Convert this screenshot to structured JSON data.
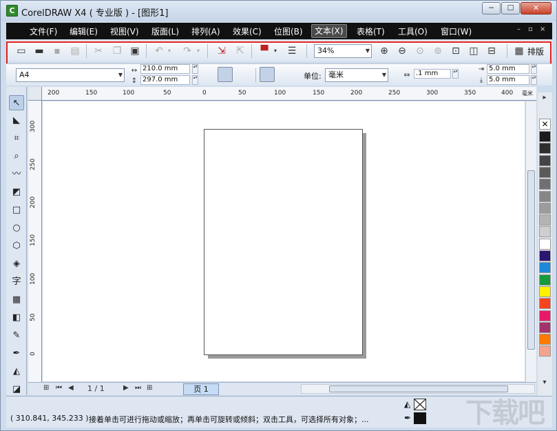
{
  "window": {
    "title": "CorelDRAW X4 ( 专业版 ) - [图形1]",
    "app_icon": "coreldraw-app-icon",
    "minimize": "─",
    "maximize": "☐",
    "close": "✕"
  },
  "menu": {
    "items": [
      "文件(F)",
      "编辑(E)",
      "视图(V)",
      "版面(L)",
      "排列(A)",
      "效果(C)",
      "位图(B)",
      "文本(X)",
      "表格(T)",
      "工具(O)",
      "窗口(W)"
    ],
    "active_index": 7,
    "mdi_min": "–",
    "mdi_restore": "▫",
    "mdi_close": "×"
  },
  "standard_toolbar": {
    "zoom_value": "34%",
    "layout_label": "排版"
  },
  "property_bar": {
    "paper_size": "A4",
    "width": "210.0 mm",
    "height": "297.0 mm",
    "units_label": "单位:",
    "units_value": "毫米",
    "nudge": ".1 mm",
    "dup_x": "5.0 mm",
    "dup_y": "5.0 mm"
  },
  "rulers": {
    "h_ticks": [
      "200",
      "150",
      "100",
      "50",
      "0",
      "50",
      "100",
      "150",
      "200",
      "250",
      "300",
      "350",
      "400"
    ],
    "h_unit": "毫米",
    "v_ticks": [
      "300",
      "250",
      "200",
      "150",
      "100",
      "50",
      "0"
    ]
  },
  "toolbox": {
    "icons": [
      "pick-tool-icon",
      "shape-tool-icon",
      "crop-tool-icon",
      "zoom-tool-icon",
      "freehand-tool-icon",
      "smart-fill-tool-icon",
      "rectangle-tool-icon",
      "ellipse-tool-icon",
      "polygon-tool-icon",
      "basic-shapes-tool-icon",
      "text-tool-icon",
      "table-tool-icon",
      "interactive-blend-tool-icon",
      "eyedropper-tool-icon",
      "outline-tool-icon",
      "fill-tool-icon",
      "interactive-fill-tool-icon"
    ],
    "text_tool_glyph": "字"
  },
  "palette": {
    "colors": [
      "#1a1a1a",
      "#2e2e2e",
      "#444444",
      "#5a5a5a",
      "#707070",
      "#868686",
      "#9c9c9c",
      "#b4b4b4",
      "#cfcfcf",
      "#ffffff",
      "#2b1670",
      "#1e88d8",
      "#169a3c",
      "#ffef00",
      "#f4451f",
      "#e8196b",
      "#a3336b",
      "#ff7a00",
      "#f4a48c"
    ]
  },
  "page_nav": {
    "counter": "1 / 1",
    "page_tab": "页 1"
  },
  "status": {
    "coords": "( 310.841, 345.233 )",
    "hint": "接着单击可进行拖动或缩放；再单击可旋转或倾斜；双击工具，可选择所有对象；...",
    "watermark": "下载吧"
  }
}
